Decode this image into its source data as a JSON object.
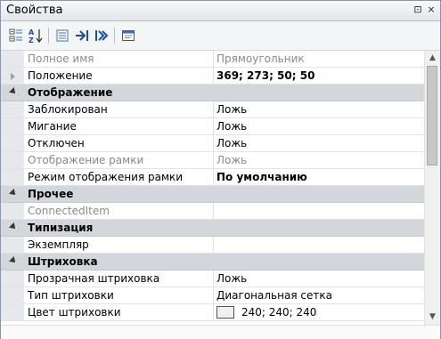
{
  "window": {
    "title": "Свойства",
    "pin_glyph": "⊡",
    "close_glyph": "×"
  },
  "toolbar": {
    "buttons": [
      {
        "name": "categorized-view",
        "icon": "categorized-icon"
      },
      {
        "name": "alphabetical-sort",
        "icon": "sort-az-icon"
      },
      {
        "name": "property-pages",
        "icon": "list-icon"
      },
      {
        "name": "expand-all",
        "icon": "expand-icon"
      },
      {
        "name": "collapse-all",
        "icon": "collapse-icon"
      },
      {
        "name": "events",
        "icon": "window-icon"
      }
    ],
    "sort_label": "AZ"
  },
  "grid": {
    "header": {
      "name": "Полное имя",
      "value": "Прямоугольник"
    },
    "position": {
      "name": "Положение",
      "value": "369; 273; 50; 50"
    },
    "categories": {
      "display": "Отображение",
      "other": "Прочее",
      "typing": "Типизация",
      "hatch": "Штриховка"
    },
    "display_rows": [
      {
        "name": "Заблокирован",
        "value": "Ложь"
      },
      {
        "name": "Мигание",
        "value": "Ложь"
      },
      {
        "name": "Отключен",
        "value": "Ложь"
      },
      {
        "name": "Отображение рамки",
        "value": "Ложь"
      },
      {
        "name": "Режим отображения рамки",
        "value": "По умолчанию"
      }
    ],
    "other_rows": [
      {
        "name": "ConnectedItem",
        "value": ""
      }
    ],
    "typing_rows": [
      {
        "name": "Экземпляр",
        "value": ""
      }
    ],
    "hatch_rows": [
      {
        "name": "Прозрачная штриховка",
        "value": "Ложь"
      },
      {
        "name": "Тип штриховки",
        "value": "Диагональная сетка"
      },
      {
        "name": "Цвет штриховки",
        "value": "240; 240; 240",
        "swatch": "#f0f0f0"
      }
    ]
  },
  "colors": {
    "category_bg": "#d3d6da",
    "gutter_bg": "#e6e8eb",
    "disabled_text": "#8a8a8a"
  }
}
